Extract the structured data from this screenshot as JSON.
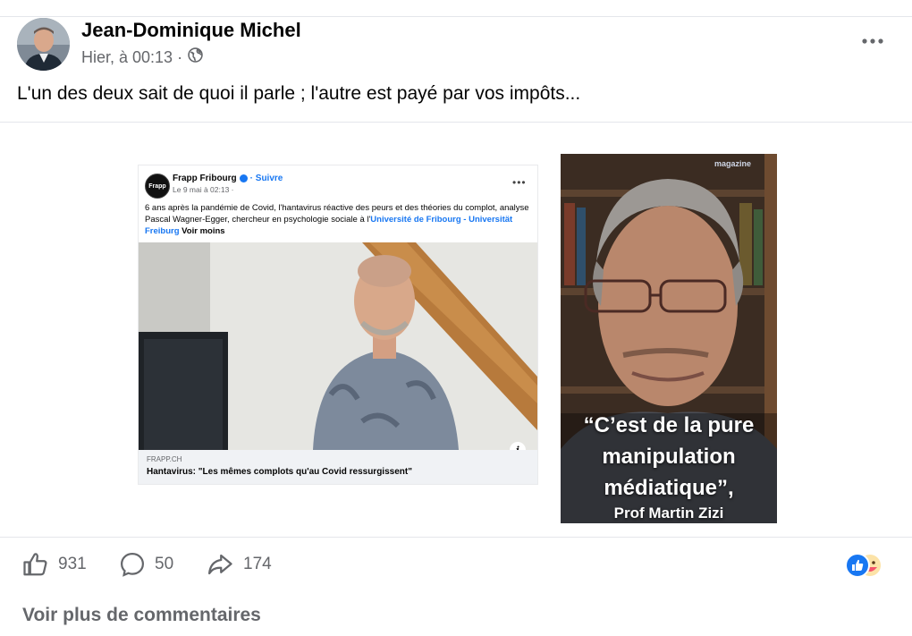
{
  "post": {
    "author": "Jean-Dominique Michel",
    "timestamp": "Hier, à 00:13 ·",
    "audience_icon": "globe-icon",
    "caption": "L'un des deux sait de quoi il parle ; l'autre est payé par vos impôts..."
  },
  "embedded_post": {
    "logo_text": "Frapp",
    "page_name": "Frapp Fribourg",
    "follow_label": "· Suivre",
    "date": "Le 9 mai à 02:13 ·",
    "text_main": "6 ans après la pandémie de Covid, l'hantavirus réactive des peurs et des théories du complot, analyse Pascal Wagner-Egger, chercheur en psychologie sociale à l'",
    "text_link": "Université de Fribourg - Universität Freiburg",
    "see_less": "Voir moins",
    "link_domain": "FRAPP.CH",
    "link_headline": "Hantavirus: \"Les mêmes complots qu'au Covid ressurgissent\""
  },
  "portrait": {
    "watermark": "magazine",
    "quote_line1": "“C’est de la pure",
    "quote_line2": "manipulation",
    "quote_line3": "médiatique”,",
    "quote_author": "Prof Martin Zizi"
  },
  "actions": {
    "likes": "931",
    "comments": "50",
    "shares": "174"
  },
  "footer": {
    "view_more": "Voir plus de commentaires"
  },
  "colors": {
    "accent": "#1877f2",
    "secondary_text": "#65676b"
  }
}
